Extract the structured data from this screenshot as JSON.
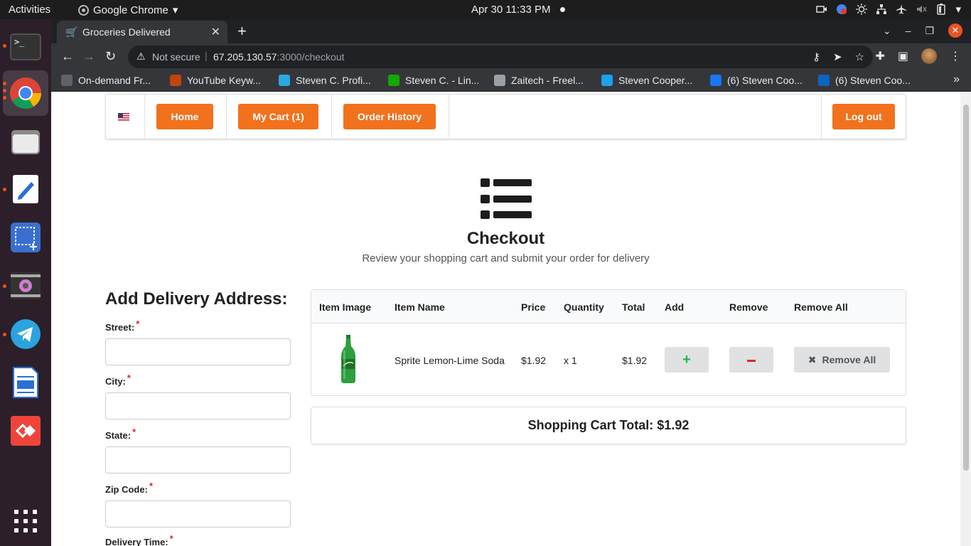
{
  "os": {
    "activities": "Activities",
    "app_name": "Google Chrome",
    "clock": "Apr 30  11:33 PM"
  },
  "browser": {
    "tab_title": "Groceries Delivered",
    "security_label": "Not secure",
    "url_host": "67.205.130.57",
    "url_path": ":3000/checkout",
    "bookmarks": [
      {
        "label": "On-demand Fr...",
        "color": "#5f6368"
      },
      {
        "label": "YouTube Keyw...",
        "color": "#c1440e"
      },
      {
        "label": "Steven C. Profi...",
        "color": "#29a9e1"
      },
      {
        "label": "Steven C. - Lin...",
        "color": "#14a800"
      },
      {
        "label": "Zaitech - Freel...",
        "color": "#9aa0a6"
      },
      {
        "label": "Steven Cooper...",
        "color": "#1da1f2"
      },
      {
        "label": "(6) Steven Coo...",
        "color": "#1877f2"
      },
      {
        "label": "(6) Steven Coo...",
        "color": "#0a66c2"
      }
    ]
  },
  "nav": {
    "home": "Home",
    "cart": "My Cart (1)",
    "history": "Order History",
    "logout": "Log out"
  },
  "header": {
    "title": "Checkout",
    "subtitle": "Review your shopping cart and submit your order for delivery"
  },
  "address_form": {
    "title": "Add Delivery Address:",
    "required_mark": "*",
    "fields": [
      {
        "label": "Street:",
        "value": ""
      },
      {
        "label": "City:",
        "value": ""
      },
      {
        "label": "State:",
        "value": ""
      },
      {
        "label": "Zip Code:",
        "value": ""
      },
      {
        "label": "Delivery Time:",
        "value": ""
      }
    ]
  },
  "cart": {
    "columns": [
      "Item Image",
      "Item Name",
      "Price",
      "Quantity",
      "Total",
      "Add",
      "Remove",
      "Remove All"
    ],
    "rows": [
      {
        "name": "Sprite Lemon-Lime Soda",
        "price": "$1.92",
        "quantity": "x 1",
        "total": "$1.92",
        "remove_all_label": "Remove All"
      }
    ],
    "total_label": "Shopping Cart Total: $1.92"
  },
  "colors": {
    "accent": "#f2711c",
    "add_green": "#21ba45",
    "remove_red": "#db2828"
  }
}
